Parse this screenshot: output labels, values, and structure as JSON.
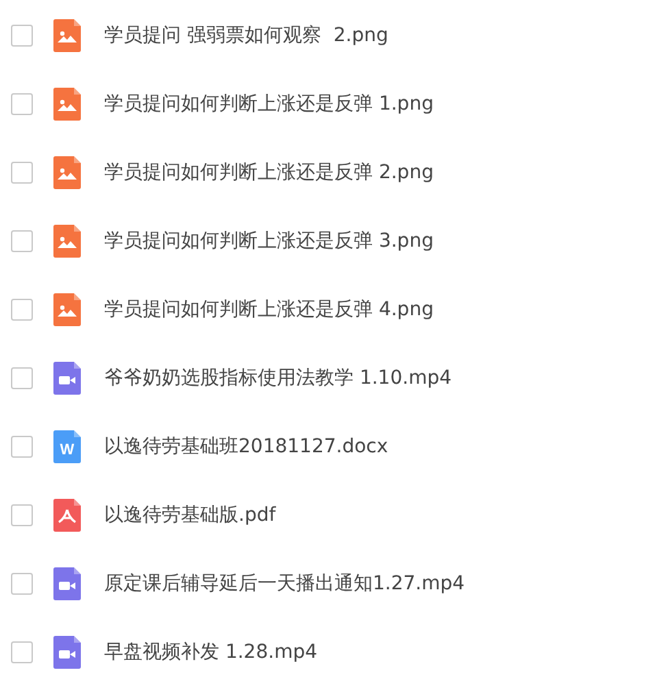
{
  "files": [
    {
      "name": "学员提问 强弱票如何观察  2.png",
      "kind": "image",
      "checked": false
    },
    {
      "name": "学员提问如何判断上涨还是反弹 1.png",
      "kind": "image",
      "checked": false
    },
    {
      "name": "学员提问如何判断上涨还是反弹 2.png",
      "kind": "image",
      "checked": false
    },
    {
      "name": "学员提问如何判断上涨还是反弹 3.png",
      "kind": "image",
      "checked": false
    },
    {
      "name": "学员提问如何判断上涨还是反弹 4.png",
      "kind": "image",
      "checked": false
    },
    {
      "name": "爷爷奶奶选股指标使用法教学 1.10.mp4",
      "kind": "video",
      "checked": false
    },
    {
      "name": "以逸待劳基础班20181127.docx",
      "kind": "word",
      "icon_letter": "W",
      "checked": false
    },
    {
      "name": "以逸待劳基础版.pdf",
      "kind": "pdf",
      "checked": false
    },
    {
      "name": "原定课后辅导延后一天播出通知1.27.mp4",
      "kind": "video",
      "checked": false
    },
    {
      "name": "早盘视频补发 1.28.mp4",
      "kind": "video",
      "checked": false
    }
  ]
}
